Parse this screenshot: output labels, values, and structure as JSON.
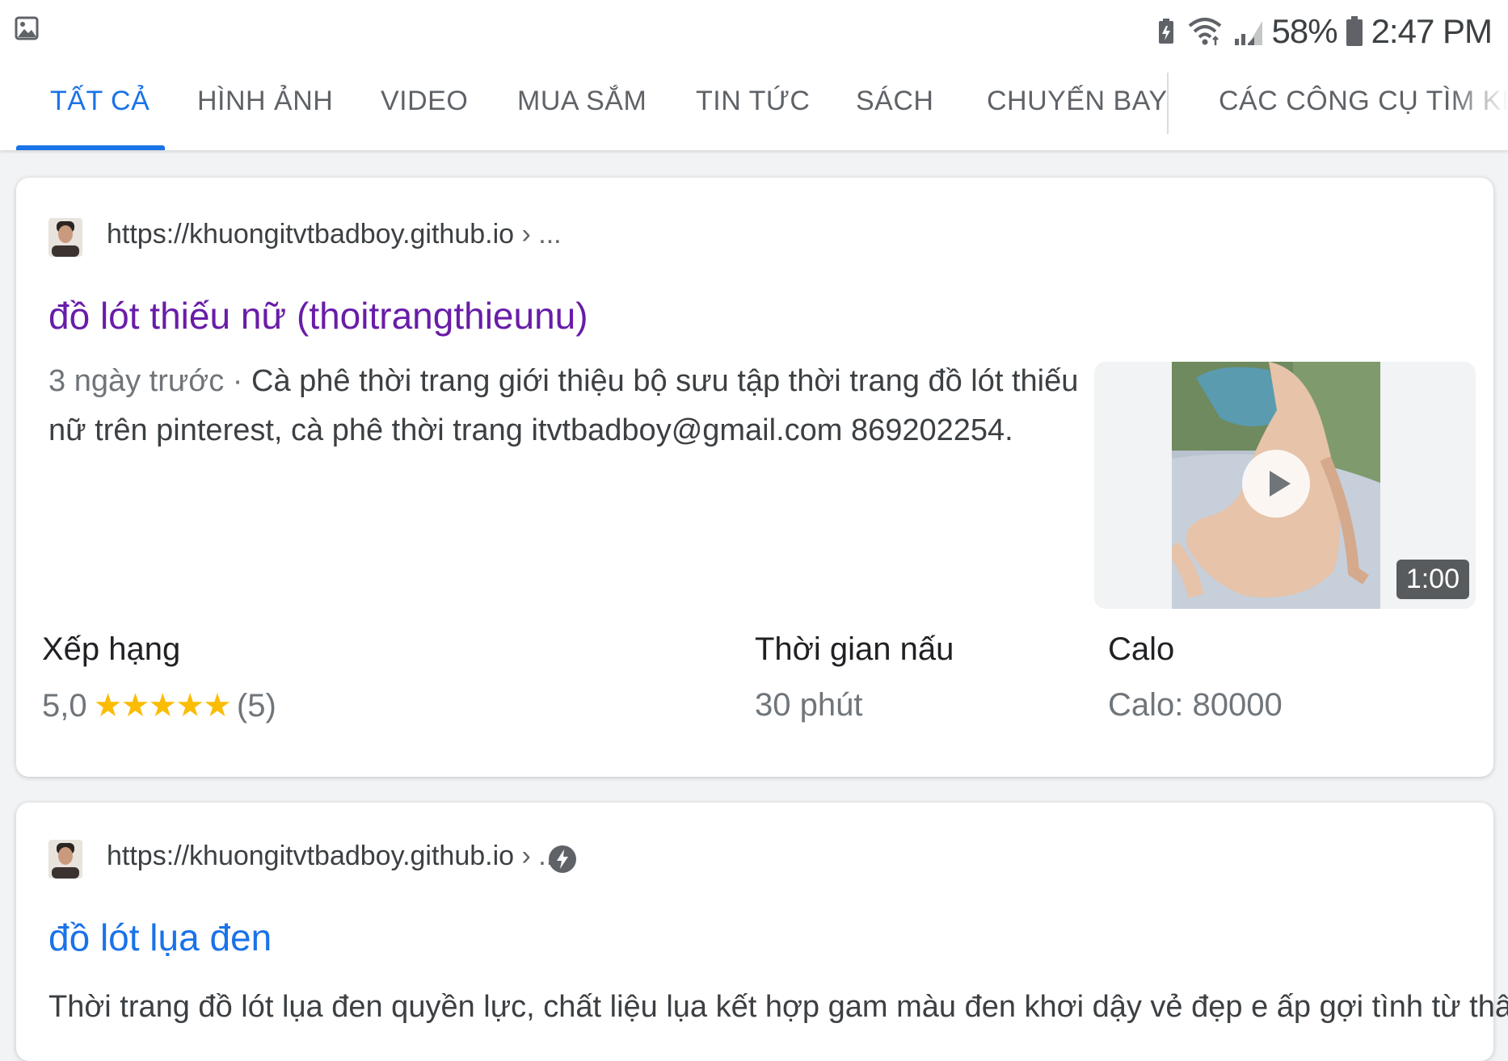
{
  "status_bar": {
    "battery_percent": "58%",
    "time": "2:47 PM",
    "icons": [
      "image-notification-icon",
      "battery-saver-icon",
      "wifi-icon",
      "signal-icon",
      "battery-icon"
    ]
  },
  "tabs": {
    "items": [
      {
        "label": "TẤT CẢ",
        "active": true
      },
      {
        "label": "HÌNH ẢNH",
        "active": false
      },
      {
        "label": "VIDEO",
        "active": false
      },
      {
        "label": "MUA SẮM",
        "active": false
      },
      {
        "label": "TIN TỨC",
        "active": false
      },
      {
        "label": "SÁCH",
        "active": false
      },
      {
        "label": "CHUYẾN BAY",
        "active": false
      }
    ],
    "tools_label": "CÁC CÔNG CỤ TÌM KIẾM"
  },
  "results": [
    {
      "url": "https://khuongitvtbadboy.github.io",
      "breadcrumb": "› ...",
      "title": "đồ lót thiếu nữ (thoitrangthieunu)",
      "date": "3 ngày trước",
      "separator": "·",
      "snippet": "Cà phê thời trang giới thiệu bộ sưu tập thời trang đồ lót thiếu nữ trên pinterest, cà phê thời trang itvtbadboy@gmail.com 869202254.",
      "video_duration": "1:00",
      "facts": [
        {
          "label": "Xếp hạng",
          "rating": "5,0",
          "stars": "★★★★★",
          "star_count": 5,
          "reviews": "(5)"
        },
        {
          "label": "Thời gian nấu",
          "value": "30 phút"
        },
        {
          "label": "Calo",
          "value": "Calo: 80000"
        }
      ]
    },
    {
      "url": "https://khuongitvtbadboy.github.io",
      "breadcrumb": "› ...",
      "amp_icon": "lightning-amp-icon",
      "title": "đồ lót lụa đen",
      "snippet": "Thời trang đồ lót lụa đen quyền lực, chất liệu lụa kết hợp gam màu đen khơi dậy vẻ đẹp e ấp gợi tình từ thân"
    }
  ],
  "colors": {
    "accent": "#1a73e8",
    "visited_link": "#681da8",
    "star": "#fbbc04",
    "muted_text": "#70757a"
  }
}
